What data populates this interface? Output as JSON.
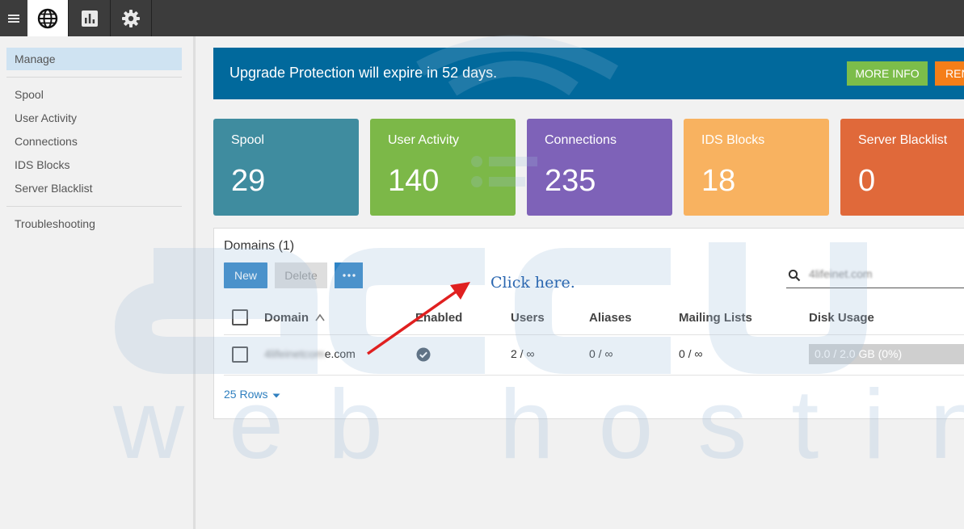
{
  "topbar": {
    "tabs": [
      {
        "icon": "globe-icon",
        "active": true
      },
      {
        "icon": "bar-chart-icon",
        "active": false
      },
      {
        "icon": "gear-icon",
        "active": false
      }
    ]
  },
  "sidebar": {
    "active": "Manage",
    "items": [
      "Spool",
      "User Activity",
      "Connections",
      "IDS Blocks",
      "Server Blacklist"
    ],
    "footer_item": "Troubleshooting"
  },
  "banner": {
    "text": "Upgrade Protection will expire in 52 days.",
    "more_info": "MORE INFO",
    "renew": "RENEW"
  },
  "stats": [
    {
      "title": "Spool",
      "value": "29",
      "color": "#3f8c9f"
    },
    {
      "title": "User Activity",
      "value": "140",
      "color": "#7cb848"
    },
    {
      "title": "Connections",
      "value": "235",
      "color": "#7e62b8"
    },
    {
      "title": "IDS Blocks",
      "value": "18",
      "color": "#f8b260"
    },
    {
      "title": "Server Blacklist",
      "value": "0",
      "color": "#e0693a"
    }
  ],
  "domains": {
    "title": "Domains (1)",
    "new_label": "New",
    "delete_label": "Delete",
    "search_value": "4lifeinet.com",
    "columns": [
      "Domain",
      "Enabled",
      "Users",
      "Aliases",
      "Mailing Lists",
      "Disk Usage"
    ],
    "row": {
      "domain_blurred": "4lifeinetcom",
      "domain_suffix": "e.com",
      "users": "2 / ∞",
      "aliases": "0 / ∞",
      "mailing_lists": "0 / ∞",
      "disk_usage": "0.0 / 2.0 GB (0%)"
    },
    "rows_label": "25 Rows"
  },
  "annotation": {
    "text": "Click here."
  },
  "watermark": {
    "text": "web hosting"
  },
  "colors": {
    "topbar": "#3c3c3c",
    "banner": "#01699c",
    "primary_button": "#2e84c6",
    "more_info": "#7cbd4a",
    "renew": "#f57e18",
    "arrow": "#e02020"
  }
}
